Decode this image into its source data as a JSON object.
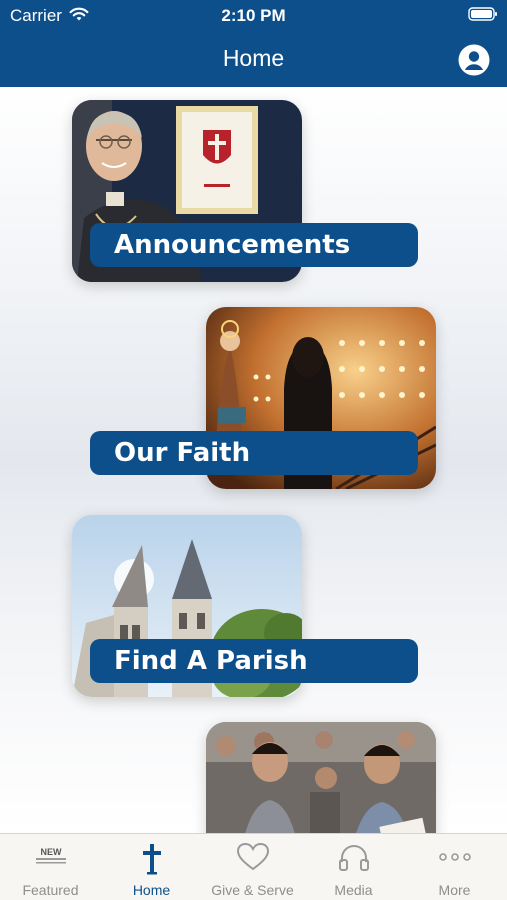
{
  "status_bar": {
    "carrier": "Carrier",
    "time": "2:10 PM"
  },
  "nav": {
    "title": "Home",
    "profile_icon": "person-circle-icon"
  },
  "tiles": [
    {
      "label": "Announcements",
      "image": "bishop-photo"
    },
    {
      "label": "Our Faith",
      "image": "candle-chapel-photo"
    },
    {
      "label": "Find A Parish",
      "image": "church-towers-photo"
    },
    {
      "label": "",
      "image": "youth-gathering-photo"
    }
  ],
  "tab_bar": {
    "tabs": [
      {
        "label": "Featured",
        "icon": "new-badge-icon",
        "badge": "NEW"
      },
      {
        "label": "Home",
        "icon": "cross-icon"
      },
      {
        "label": "Give & Serve",
        "icon": "heart-icon"
      },
      {
        "label": "Media",
        "icon": "headphones-icon"
      },
      {
        "label": "More",
        "icon": "more-dots-icon"
      }
    ],
    "active": "Home"
  },
  "colors": {
    "brand_blue": "#0d4f8b",
    "inactive_gray": "#8e8e8e"
  }
}
